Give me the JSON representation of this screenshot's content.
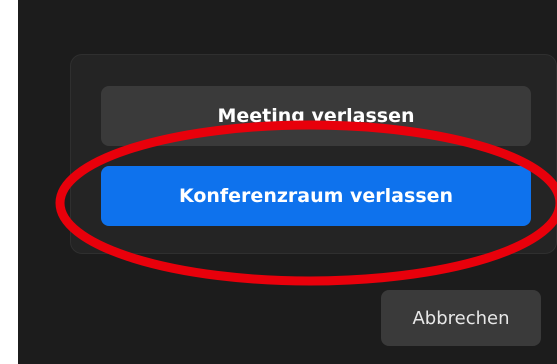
{
  "dialog": {
    "leave_meeting_label": "Meeting verlassen",
    "leave_breakout_label": "Konferenzraum verlassen",
    "cancel_label": "Abbrechen"
  },
  "colors": {
    "window_bg": "#1c1c1c",
    "popover_bg": "#242424",
    "secondary_button": "#3a3a3a",
    "primary_button": "#0e72ed",
    "annotation": "#e8000b"
  }
}
